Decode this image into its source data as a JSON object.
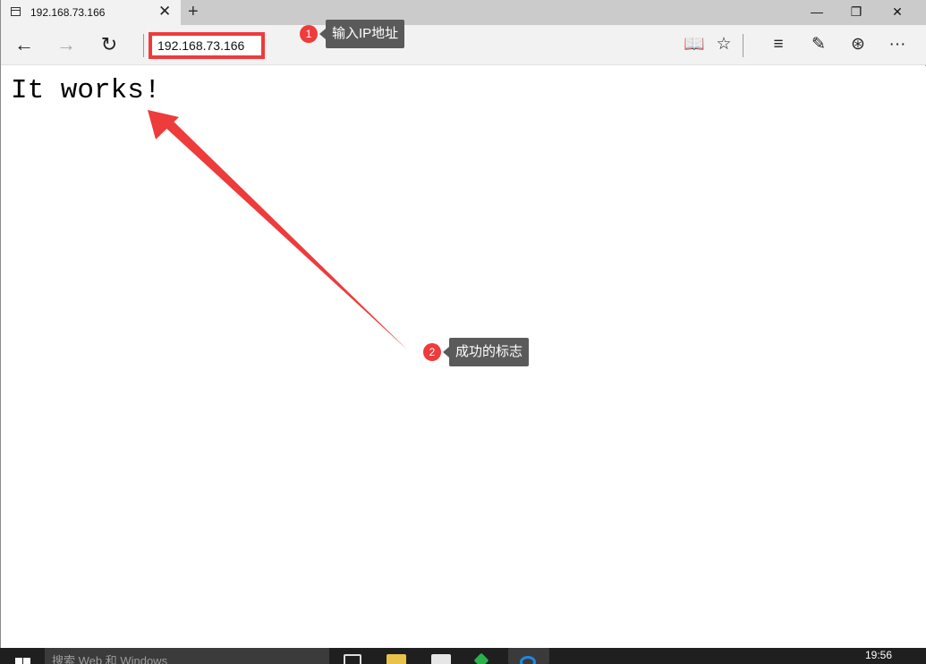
{
  "browser": {
    "tab_title": "192.168.73.166",
    "tab_close": "✕",
    "new_tab": "+",
    "window_controls": {
      "minimize": "—",
      "restore": "❐",
      "close": "✕"
    },
    "nav": {
      "back": "←",
      "forward": "→",
      "refresh": "↻"
    },
    "address_value": "192.168.73.166",
    "toolbar": {
      "reading_view": "📖",
      "favorite": "☆",
      "hub": "≡",
      "web_note": "✎",
      "share": "⊛",
      "more": "···"
    }
  },
  "page": {
    "heading": "It works!"
  },
  "annotations": [
    {
      "number": "1",
      "text": "输入IP地址"
    },
    {
      "number": "2",
      "text": "成功的标志"
    }
  ],
  "colors": {
    "annotation_red": "#ee3b3b",
    "callout_bg": "#5a5a5a"
  },
  "taskbar": {
    "search_placeholder": "搜索 Web 和 Windows",
    "clock": "19:56",
    "icons": [
      "windows-logo-icon",
      "task-view-icon",
      "file-explorer-icon",
      "store-icon",
      "app-icon",
      "edge-icon"
    ]
  }
}
